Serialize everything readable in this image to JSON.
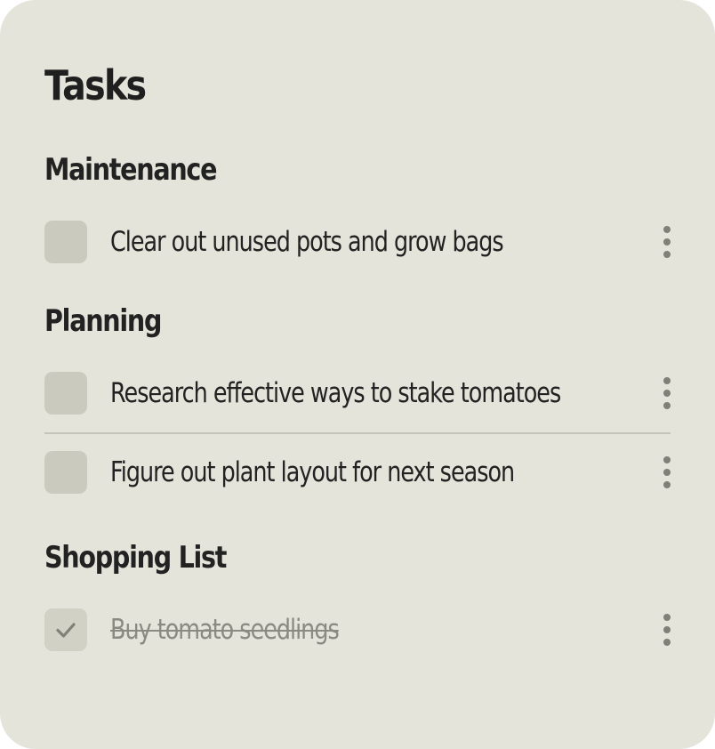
{
  "title": "Tasks",
  "sections": [
    {
      "title": "Maintenance",
      "tasks": [
        {
          "label": "Clear out unused pots and grow bags",
          "done": false
        }
      ]
    },
    {
      "title": "Planning",
      "tasks": [
        {
          "label": "Research effective ways to stake tomatoes",
          "done": false
        },
        {
          "label": "Figure out plant layout for next season",
          "done": false
        }
      ]
    },
    {
      "title": "Shopping List",
      "tasks": [
        {
          "label": "Buy tomato seedlings",
          "done": true
        }
      ]
    }
  ],
  "colors": {
    "card_background": "#e4e4da",
    "checkbox": "#cbcabe",
    "divider": "#c4c4b8",
    "done_text": "#8a8a83",
    "icon": "#808078"
  },
  "icons": {
    "more": "vertical-ellipsis",
    "checked": "check-mark"
  }
}
